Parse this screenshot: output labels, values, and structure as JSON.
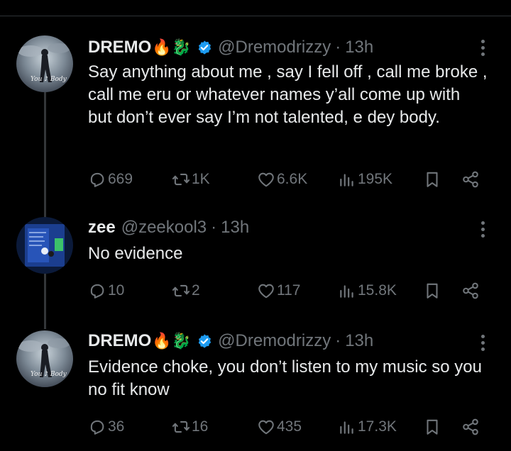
{
  "tweets": [
    {
      "name": "DREMO",
      "emojis": "🔥🐉",
      "handle": "@Dremodrizzy",
      "time": "13h",
      "text": "Say anything about me , say I fell off , call me broke , call me eru or whatever names y’all come up with\nbut don’t ever say I’m not talented, e dey body.",
      "replies": "669",
      "reposts": "1K",
      "likes": "6.6K",
      "views": "195K"
    },
    {
      "name": "zee",
      "emojis": "",
      "handle": "@zeekool3",
      "time": "13h",
      "text": "No evidence",
      "replies": "10",
      "reposts": "2",
      "likes": "117",
      "views": "15.8K"
    },
    {
      "name": "DREMO",
      "emojis": "🔥🐉",
      "handle": "@Dremodrizzy",
      "time": "13h",
      "text": "Evidence choke, you don’t listen to my music so you no fit know",
      "replies": "36",
      "reposts": "16",
      "likes": "435",
      "views": "17.3K"
    }
  ],
  "dot_separator": "·",
  "colors": {
    "background": "#000000",
    "text": "#e7e9ea",
    "muted": "#71767b",
    "verified": "#1d9bf0",
    "thread_line": "#333639"
  },
  "icons": [
    "reply-icon",
    "repost-icon",
    "like-icon",
    "views-icon",
    "bookmark-icon",
    "share-icon",
    "more-icon",
    "verified-icon"
  ]
}
